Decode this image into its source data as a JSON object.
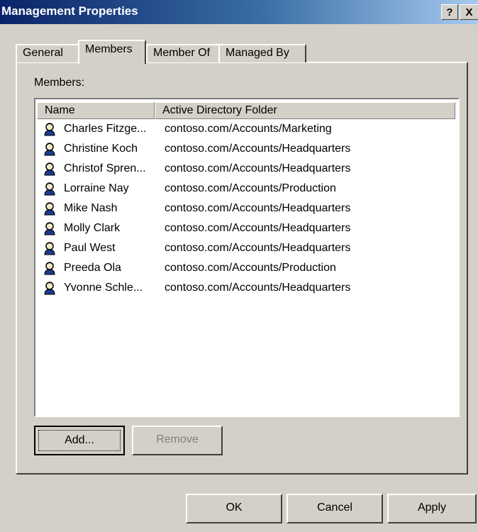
{
  "window": {
    "title": "Management Properties",
    "help_label": "?",
    "close_label": "X"
  },
  "tabs": [
    {
      "label": "General",
      "active": false
    },
    {
      "label": "Members",
      "active": true
    },
    {
      "label": "Member Of",
      "active": false
    },
    {
      "label": "Managed By",
      "active": false
    }
  ],
  "members": {
    "label": "Members:",
    "columns": [
      "Name",
      "Active Directory Folder"
    ],
    "rows": [
      {
        "name": "Charles Fitzge...",
        "folder": "contoso.com/Accounts/Marketing",
        "icon": "user-icon"
      },
      {
        "name": "Christine Koch",
        "folder": "contoso.com/Accounts/Headquarters",
        "icon": "user-icon"
      },
      {
        "name": "Christof Spren...",
        "folder": "contoso.com/Accounts/Headquarters",
        "icon": "user-icon"
      },
      {
        "name": "Lorraine Nay",
        "folder": "contoso.com/Accounts/Production",
        "icon": "user-icon"
      },
      {
        "name": "Mike Nash",
        "folder": "contoso.com/Accounts/Headquarters",
        "icon": "user-icon"
      },
      {
        "name": "Molly Clark",
        "folder": "contoso.com/Accounts/Headquarters",
        "icon": "user-icon"
      },
      {
        "name": "Paul West",
        "folder": "contoso.com/Accounts/Headquarters",
        "icon": "user-icon"
      },
      {
        "name": "Preeda Ola",
        "folder": "contoso.com/Accounts/Production",
        "icon": "user-icon"
      },
      {
        "name": "Yvonne Schle...",
        "folder": "contoso.com/Accounts/Headquarters",
        "icon": "user-icon"
      }
    ]
  },
  "buttons": {
    "add": "Add...",
    "remove": "Remove",
    "ok": "OK",
    "cancel": "Cancel",
    "apply": "Apply"
  },
  "colors": {
    "titlebar_start": "#0a246a",
    "titlebar_end": "#a6caf0",
    "face": "#d4d0c8"
  }
}
